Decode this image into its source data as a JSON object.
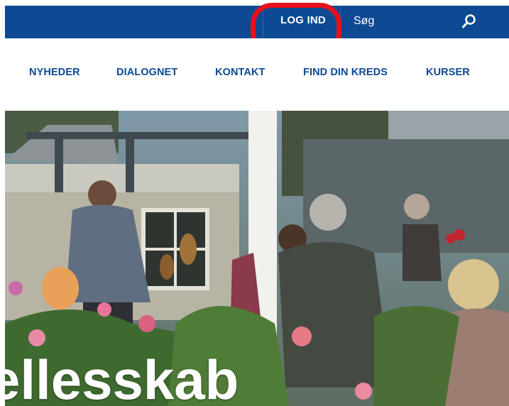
{
  "header": {
    "login_label": "LOG IND",
    "search_label": "Søg",
    "search_icon": "search-icon"
  },
  "nav": {
    "items": [
      {
        "label": "NYHEDER"
      },
      {
        "label": "DIALOGNET"
      },
      {
        "label": "KONTAKT"
      },
      {
        "label": "FIND DIN KREDS"
      },
      {
        "label": "KURSER"
      }
    ]
  },
  "hero": {
    "title": "ellesskab"
  },
  "colors": {
    "brand_blue": "#0d4a93",
    "highlight_red": "#e8101b",
    "white": "#ffffff"
  }
}
